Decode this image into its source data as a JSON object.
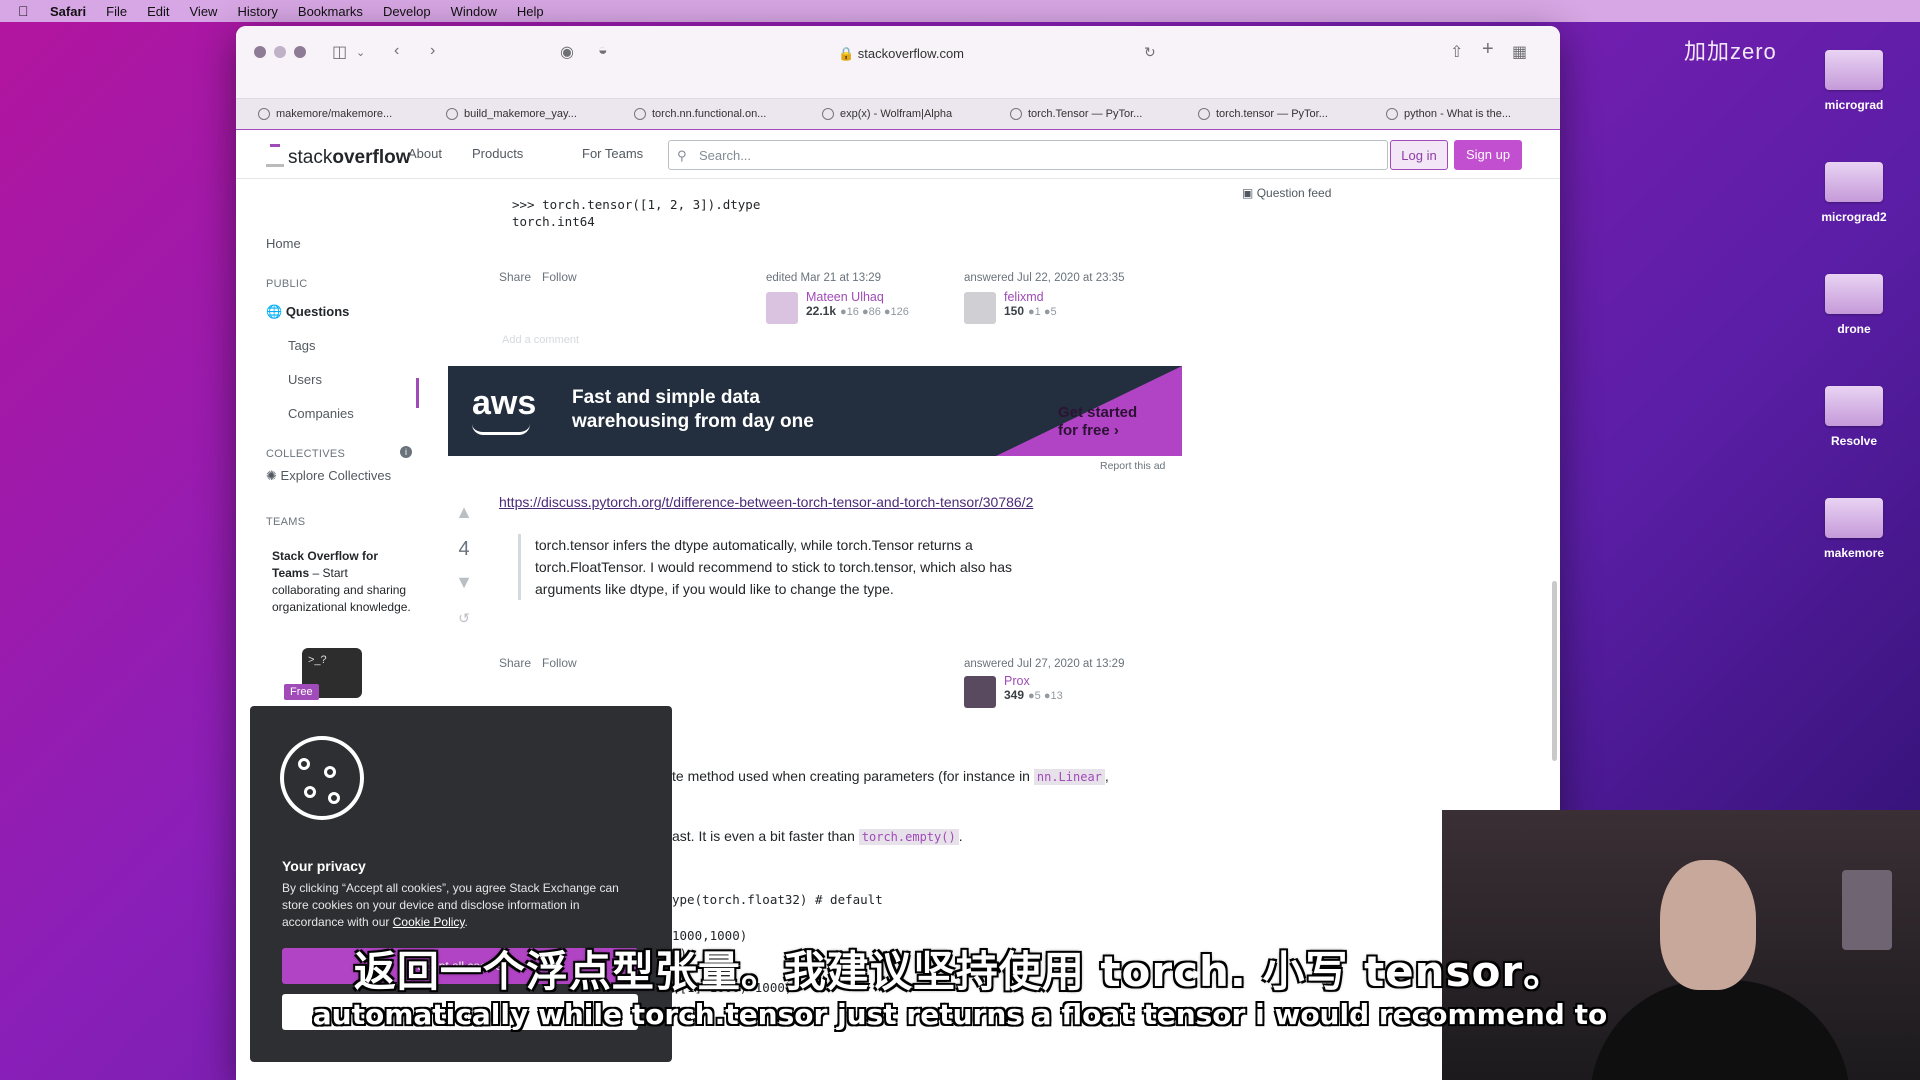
{
  "menubar": {
    "app": "Safari",
    "items": [
      "File",
      "Edit",
      "View",
      "History",
      "Bookmarks",
      "Develop",
      "Window",
      "Help"
    ]
  },
  "desktop": {
    "watermark": "加加zero",
    "items": [
      "micrograd",
      "micrograd2",
      "drone",
      "Resolve",
      "makemore"
    ]
  },
  "browser": {
    "url": "stackoverflow.com",
    "tabs": [
      "makemore/makemore...",
      "build_makemore_yay...",
      "torch.nn.functional.on...",
      "exp(x) - Wolfram|Alpha",
      "torch.Tensor — PyTor...",
      "torch.tensor — PyTor...",
      "python - What is the..."
    ]
  },
  "so_header": {
    "logo_plain": "stack",
    "logo_bold": "overflow",
    "nav": [
      "About",
      "Products",
      "For Teams"
    ],
    "search_placeholder": "Search...",
    "login": "Log in",
    "signup": "Sign up"
  },
  "sidebar": {
    "home": "Home",
    "public_label": "PUBLIC",
    "questions": "Questions",
    "tags": "Tags",
    "users": "Users",
    "companies": "Companies",
    "collectives_label": "COLLECTIVES",
    "explore_collectives": "Explore Collectives",
    "teams_label": "TEAMS",
    "teams_title": "Stack Overflow for Teams",
    "teams_text": " – Start collaborating and sharing organizational knowledge.",
    "free": "Free"
  },
  "question_feed": "Question feed",
  "answer1": {
    "code_line1": ">>> torch.tensor([1, 2, 3]).dtype",
    "code_line2": "torch.int64",
    "share": "Share",
    "follow": "Follow",
    "edited": "edited Mar 21 at 13:29",
    "editor_name": "Mateen Ulhaq",
    "editor_rep": "22.1k",
    "editor_badges": "●16 ●86 ●126",
    "answered": "answered Jul 22, 2020 at 23:35",
    "author_name": "felixmd",
    "author_rep": "150",
    "author_badges": "●1 ●5",
    "add_comment": "Add a comment"
  },
  "ad": {
    "brand": "aws",
    "headline_line1": "Fast and simple data",
    "headline_line2": "warehousing from day one",
    "cta_line1": "Get started",
    "cta_line2": "for free ›",
    "report": "Report this ad"
  },
  "answer2": {
    "votes": "4",
    "link": "https://discuss.pytorch.org/t/difference-between-torch-tensor-and-torch-tensor/30786/2",
    "quote_line1": "torch.tensor infers the dtype automatically, while torch.Tensor returns a",
    "quote_line2": "torch.FloatTensor. I would recommend to stick to torch.tensor, which also has",
    "quote_line3": "arguments like dtype, if you would like to change the type.",
    "share": "Share",
    "follow": "Follow",
    "answered": "answered Jul 27, 2020 at 13:29",
    "author_name": "Prox",
    "author_rep": "349",
    "author_badges": "●5 ●13"
  },
  "answer3_partial": {
    "line1_text": "te method used when creating parameters (for instance in ",
    "line1_code": "nn.Linear",
    "line1_end": ",",
    "line2_text": "ast. It is even a bit faster than ",
    "line2_code": "torch.empty()",
    "line2_end": ".",
    "code1": "ype(torch.float32) # default",
    "code2": "1000,1000)",
    "code3": "0)",
    "code4": "([1]*1000)*1000)"
  },
  "cookie": {
    "title": "Your privacy",
    "text": "By clicking “Accept all cookies”, you agree Stack Exchange can store cookies on your device and disclose information in accordance with our ",
    "policy": "Cookie Policy",
    "policy_end": ".",
    "accept": "Accept all cookies"
  },
  "subtitles": {
    "zh": "返回一个浮点型张量。我建议坚持使用 torch. 小写 tensor。",
    "en": "automatically while torch.tensor just returns a float tensor i would recommend to"
  }
}
